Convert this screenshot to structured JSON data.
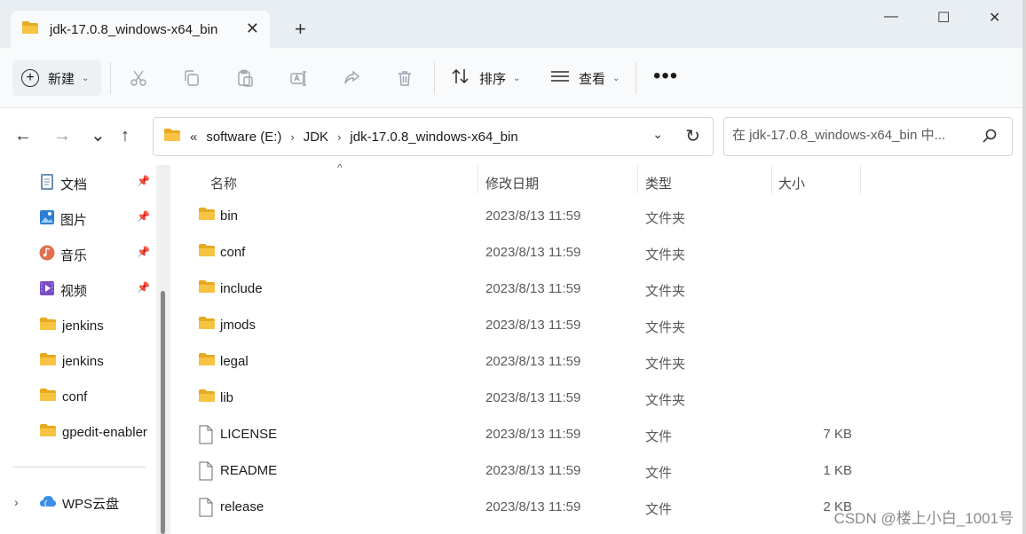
{
  "window": {
    "tab_title": "jdk-17.0.8_windows-x64_bin",
    "tab_close": "✕",
    "new_tab": "+",
    "minimize": "—",
    "maximize": "☐",
    "close": "✕"
  },
  "toolbar": {
    "new_label": "新建",
    "sort_label": "排序",
    "view_label": "查看",
    "more_label": "•••",
    "caret": "⌄",
    "icons": [
      "cut-icon",
      "copy-icon",
      "paste-icon",
      "rename-icon",
      "share-icon",
      "delete-icon"
    ]
  },
  "nav": {
    "back": "←",
    "forward": "→",
    "recent": "⌄",
    "up": "↑"
  },
  "address": {
    "overflow": "«",
    "crumbs": [
      "software (E:)",
      "JDK",
      "jdk-17.0.8_windows-x64_bin"
    ],
    "separator": "›",
    "dropdown": "⌄",
    "refresh": "↻"
  },
  "search": {
    "placeholder": "在 jdk-17.0.8_windows-x64_bin 中..."
  },
  "sidebar": {
    "items": [
      {
        "label": "文档",
        "icon": "documents-icon",
        "pinned": true
      },
      {
        "label": "图片",
        "icon": "pictures-icon",
        "pinned": true
      },
      {
        "label": "音乐",
        "icon": "music-icon",
        "pinned": true
      },
      {
        "label": "视频",
        "icon": "videos-icon",
        "pinned": true
      },
      {
        "label": "jenkins",
        "icon": "folder-icon",
        "pinned": false
      },
      {
        "label": "jenkins",
        "icon": "folder-icon",
        "pinned": false
      },
      {
        "label": "conf",
        "icon": "folder-icon",
        "pinned": false
      },
      {
        "label": "gpedit-enabler",
        "icon": "folder-icon",
        "pinned": false
      }
    ],
    "wps_label": "WPS云盘",
    "expand_chevron": "›"
  },
  "columns": {
    "name": "名称",
    "modified": "修改日期",
    "type": "类型",
    "size": "大小",
    "sort_indicator": "^"
  },
  "files": [
    {
      "name": "bin",
      "modified": "2023/8/13 11:59",
      "type": "文件夹",
      "size": "",
      "kind": "folder"
    },
    {
      "name": "conf",
      "modified": "2023/8/13 11:59",
      "type": "文件夹",
      "size": "",
      "kind": "folder"
    },
    {
      "name": "include",
      "modified": "2023/8/13 11:59",
      "type": "文件夹",
      "size": "",
      "kind": "folder"
    },
    {
      "name": "jmods",
      "modified": "2023/8/13 11:59",
      "type": "文件夹",
      "size": "",
      "kind": "folder"
    },
    {
      "name": "legal",
      "modified": "2023/8/13 11:59",
      "type": "文件夹",
      "size": "",
      "kind": "folder"
    },
    {
      "name": "lib",
      "modified": "2023/8/13 11:59",
      "type": "文件夹",
      "size": "",
      "kind": "folder"
    },
    {
      "name": "LICENSE",
      "modified": "2023/8/13 11:59",
      "type": "文件",
      "size": "7 KB",
      "kind": "file"
    },
    {
      "name": "README",
      "modified": "2023/8/13 11:59",
      "type": "文件",
      "size": "1 KB",
      "kind": "file"
    },
    {
      "name": "release",
      "modified": "2023/8/13 11:59",
      "type": "文件",
      "size": "2 KB",
      "kind": "file"
    }
  ],
  "watermark": "CSDN @楼上小白_1001号",
  "colors": {
    "folder": "#f6c343",
    "folder_dark": "#e8a920",
    "titlebar": "#e9eef3",
    "toolbar": "#f9fafb"
  }
}
